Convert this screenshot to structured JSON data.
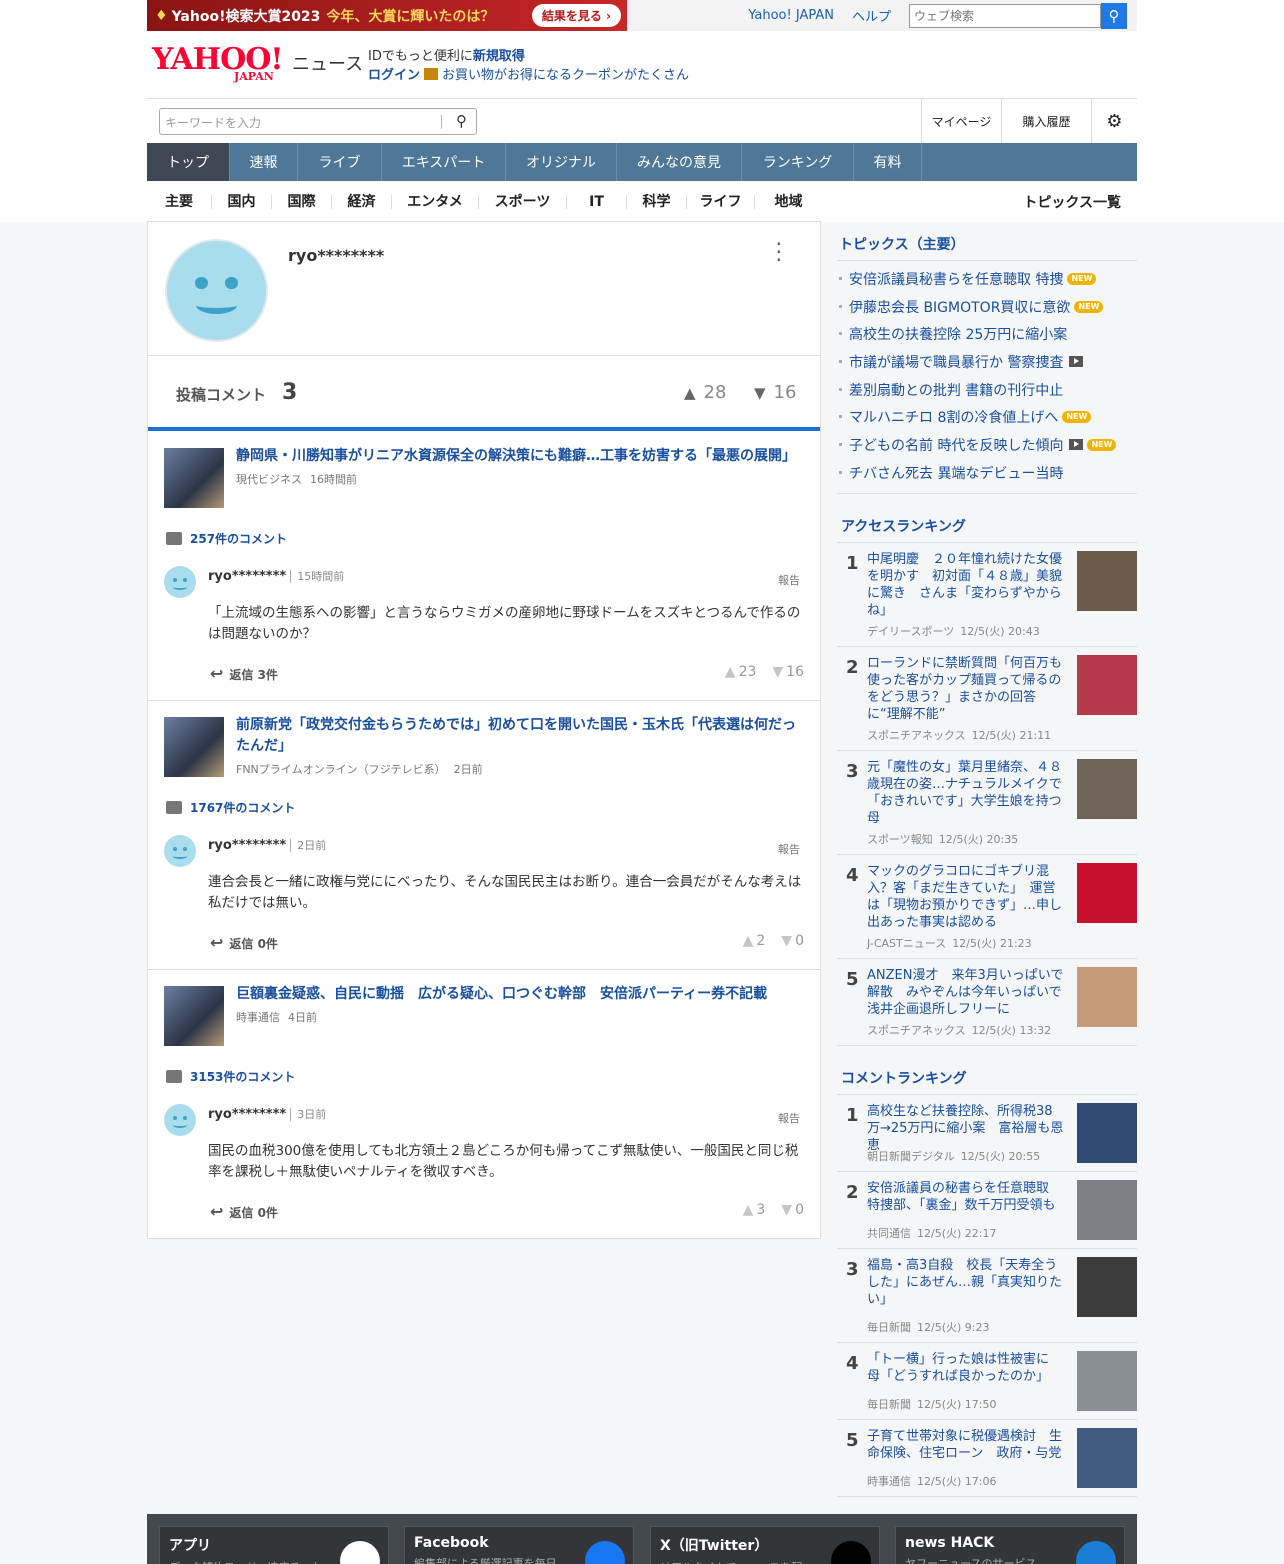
{
  "promo": {
    "icon": "diamond-icon",
    "brand": "Yahoo!検索大賞2023",
    "headline": "今年、大賞に輝いたのは？",
    "button": "結果を見る ›"
  },
  "util": {
    "yahoo_japan": "Yahoo! JAPAN",
    "help": "ヘルプ",
    "search_placeholder": "ウェブ検索"
  },
  "header": {
    "logo_text": "YAHOO!",
    "logo_sub": "JAPAN",
    "service": "ニュース",
    "id_prefix": "IDでもっと便利に",
    "signup": "新規取得",
    "login": "ログイン",
    "coupon": "お買い物がお得になるクーポンがたくさん"
  },
  "search": {
    "placeholder": "キーワードを入力",
    "mypage": "マイページ",
    "history": "購入履歴",
    "settings_icon": "gear-icon"
  },
  "nav": {
    "tabs": [
      "トップ",
      "速報",
      "ライブ",
      "エキスパート",
      "オリジナル",
      "みんなの意見",
      "ランキング",
      "有料"
    ],
    "active": 0
  },
  "subnav": {
    "items": [
      "主要",
      "国内",
      "国際",
      "経済",
      "エンタメ",
      "スポーツ",
      "IT",
      "科学",
      "ライフ",
      "地域"
    ],
    "all": "トピックス一覧"
  },
  "profile": {
    "username": "ryo********",
    "post_label": "投稿コメント",
    "post_count": "3",
    "likes": "28",
    "dislikes": "16"
  },
  "comments": [
    {
      "article_title": "静岡県・川勝知事がリニア水資源保全の解決策にも難癖…工事を妨害する「最悪の展開」",
      "source": "現代ビジネス",
      "time": "16時間前",
      "comment_count": "257件のコメント",
      "user": "ryo********",
      "posted": "15時間前",
      "report": "報告",
      "body": "「上流域の生態系への影響」と言うならウミガメの産卵地に野球ドームをスズキとつるんで作るのは問題ないのか？",
      "reply": "返信 3件",
      "likes": "23",
      "dislikes": "16"
    },
    {
      "article_title": "前原新党「政党交付金もらうためでは」初めて口を開いた国民・玉木氏「代表選は何だったんだ」",
      "source": "FNNプライムオンライン（フジテレビ系）",
      "time": "2日前",
      "comment_count": "1767件のコメント",
      "user": "ryo********",
      "posted": "2日前",
      "report": "報告",
      "body": "連合会長と一緒に政権与党ににべったり、そんな国民民主はお断り。連合一会員だがそんな考えは私だけでは無い。",
      "reply": "返信 0件",
      "likes": "2",
      "dislikes": "0"
    },
    {
      "article_title": "巨額裏金疑惑、自民に動揺　広がる疑心、口つぐむ幹部　安倍派パーティー券不記載",
      "source": "時事通信",
      "time": "4日前",
      "comment_count": "3153件のコメント",
      "user": "ryo********",
      "posted": "3日前",
      "report": "報告",
      "body": "国民の血税300億を使用しても北方領土２島どころか何も帰ってこず無駄使い、一般国民と同じ税率を課税し＋無駄使いペナルティを徴収すべき。",
      "reply": "返信 0件",
      "likes": "3",
      "dislikes": "0"
    }
  ],
  "topics": {
    "title": "トピックス（主要）",
    "items": [
      {
        "text": "安倍派議員秘書らを任意聴取 特捜",
        "new": true,
        "video": false
      },
      {
        "text": "伊藤忠会長 BIGMOTOR買収に意欲",
        "new": true,
        "video": false
      },
      {
        "text": "高校生の扶養控除 25万円に縮小案",
        "new": false,
        "video": false
      },
      {
        "text": "市議が議場で職員暴行か 警察捜査",
        "new": false,
        "video": true
      },
      {
        "text": "差別扇動との批判 書籍の刊行中止",
        "new": false,
        "video": false
      },
      {
        "text": "マルハニチロ 8割の冷食値上げへ",
        "new": true,
        "video": false
      },
      {
        "text": "子どもの名前 時代を反映した傾向",
        "new": true,
        "video": true
      },
      {
        "text": "チバさん死去 異端なデビュー当時",
        "new": false,
        "video": false
      }
    ],
    "new_label": "NEW"
  },
  "access_ranking": {
    "title": "アクセスランキング",
    "items": [
      {
        "rank": "1",
        "title": "中尾明慶　２０年憧れ続けた女優を明かす　初対面「４８歳」美貌に驚き　さんま「変わらずやからね」",
        "source": "デイリースポーツ",
        "time": "12/5(火) 20:43",
        "color": "#6b5a4a"
      },
      {
        "rank": "2",
        "title": "ローランドに禁断質問「何百万も使った客がカップ麺買って帰るのをどう思う？」まさかの回答に“理解不能”",
        "source": "スポニチアネックス",
        "time": "12/5(火) 21:11",
        "color": "#b73a4a"
      },
      {
        "rank": "3",
        "title": "元「魔性の女」葉月里緒奈、４８歳現在の姿…ナチュラルメイクで「おきれいです」大学生娘を持つ母",
        "source": "スポーツ報知",
        "time": "12/5(火) 20:35",
        "color": "#6d6558"
      },
      {
        "rank": "4",
        "title": "マックのグラコロにゴキブリ混入？客「まだ生きていた」　運営は「現物お預かりできず」…申し出あった事実は認める",
        "source": "J-CASTニュース",
        "time": "12/5(火) 21:23",
        "color": "#c8102e"
      },
      {
        "rank": "5",
        "title": "ANZEN漫才　来年3月いっぱいで解散　みやぞんは今年いっぱいで浅井企画退所しフリーに",
        "source": "スポニチアネックス",
        "time": "12/5(火) 13:32",
        "color": "#c79a78"
      }
    ]
  },
  "comment_ranking": {
    "title": "コメントランキング",
    "items": [
      {
        "rank": "1",
        "title": "高校生など扶養控除、所得税38万→25万円に縮小案　富裕層も恩恵",
        "source": "朝日新聞デジタル",
        "time": "12/5(火) 20:55",
        "color": "#2f4a73"
      },
      {
        "rank": "2",
        "title": "安倍派議員の秘書らを任意聴取　特捜部、「裏金」数千万円受領も",
        "source": "共同通信",
        "time": "12/5(火) 22:17",
        "color": "#7d8087"
      },
      {
        "rank": "3",
        "title": "福島・高3自殺　校長「天寿全うした」にあぜん…親「真実知りたい」",
        "source": "毎日新聞",
        "time": "12/5(火) 9:23",
        "color": "#3c3c3c"
      },
      {
        "rank": "4",
        "title": "「トー横」行った娘は性被害に　母「どうすれば良かったのか」",
        "source": "毎日新聞",
        "time": "12/5(火) 17:50",
        "color": "#8a8f96"
      },
      {
        "rank": "5",
        "title": "子育て世帯対象に税優遇検討　生命保険、住宅ローン　政府・与党",
        "source": "時事通信",
        "time": "12/5(火) 17:06",
        "color": "#405a80"
      }
    ]
  },
  "footer": [
    {
      "title": "アプリ",
      "sub": "データ節約モード、速度チャも",
      "icon": "app-icon",
      "color": "#ffffff"
    },
    {
      "title": "Facebook",
      "sub": "編集部による厳選記事を毎日",
      "icon": "facebook-icon",
      "color": "#1877f2"
    },
    {
      "title": "X（旧Twitter）",
      "sub": "リアルタイムでニュースを配",
      "icon": "x-icon",
      "color": "#000000"
    },
    {
      "title": "news HACK",
      "sub": "ヤフーニュースのサービス",
      "icon": "newshack-icon",
      "color": "#1a7fd4"
    }
  ]
}
